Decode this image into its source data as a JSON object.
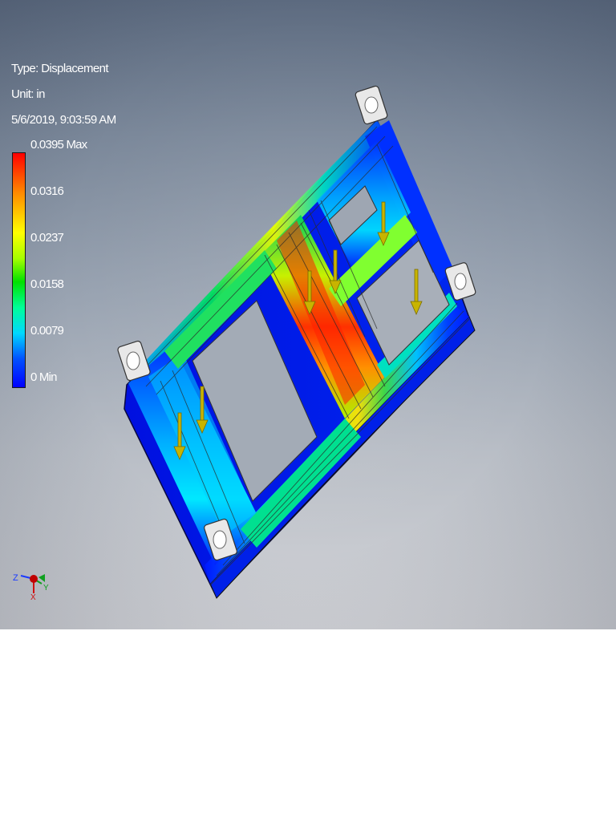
{
  "result_info": {
    "type": "Type: Displacement",
    "unit": "Unit: in",
    "timestamp": "5/6/2019, 9:03:59 AM"
  },
  "legend": {
    "max_label": "0.0395 Max",
    "labels": [
      "0.0316",
      "0.0237",
      "0.0158",
      "0.0079"
    ],
    "min_label": "0 Min",
    "colors": [
      "#ff0000",
      "#ff8a00",
      "#ffff00",
      "#00e000",
      "#00ffd0",
      "#0050ff",
      "#0000ff"
    ]
  },
  "triad": {
    "axis_z": "Z",
    "axis_x": "X",
    "axis_y": "Y"
  },
  "icons": [
    "displacement-contour-model",
    "load-arrow-icon",
    "fixed-constraint-icon",
    "view-triad-icon"
  ]
}
